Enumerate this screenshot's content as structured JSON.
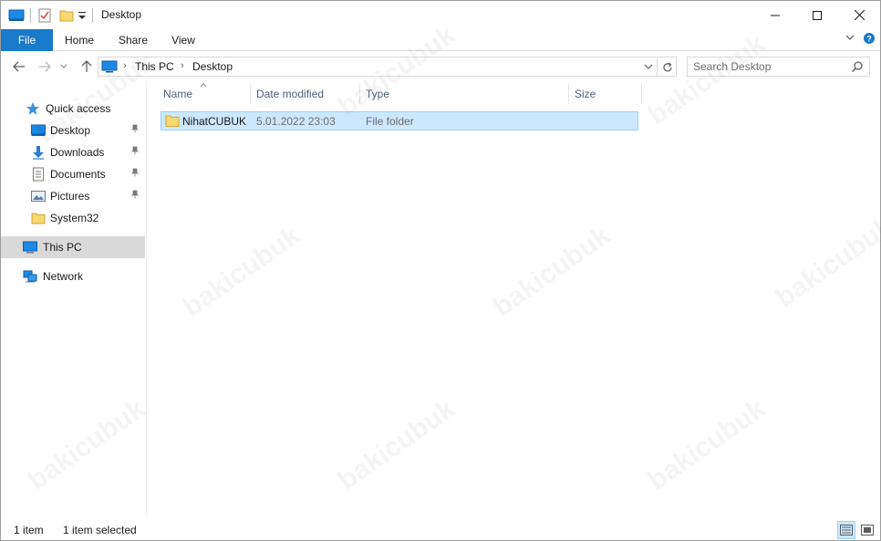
{
  "window": {
    "title": "Desktop"
  },
  "ribbon": {
    "tabs": [
      {
        "label": "File"
      },
      {
        "label": "Home"
      },
      {
        "label": "Share"
      },
      {
        "label": "View"
      }
    ]
  },
  "address": {
    "crumbs": [
      "This PC",
      "Desktop"
    ]
  },
  "search": {
    "placeholder": "Search Desktop"
  },
  "nav": {
    "quick_access": "Quick access",
    "items": [
      {
        "label": "Desktop",
        "pinned": true
      },
      {
        "label": "Downloads",
        "pinned": true
      },
      {
        "label": "Documents",
        "pinned": true
      },
      {
        "label": "Pictures",
        "pinned": true
      },
      {
        "label": "System32",
        "pinned": false
      }
    ],
    "this_pc": "This PC",
    "network": "Network"
  },
  "columns": {
    "name": "Name",
    "date_modified": "Date modified",
    "type": "Type",
    "size": "Size"
  },
  "files": [
    {
      "name": "NihatCUBUK",
      "date_modified": "5.01.2022 23:03",
      "type": "File folder",
      "size": ""
    }
  ],
  "status": {
    "count": "1 item",
    "selection": "1 item selected"
  },
  "watermark": "bakicubuk",
  "colors": {
    "accent": "#1979ca",
    "selection": "#cce8ff",
    "selection_border": "#99d1ff",
    "folder": "#f8d775"
  }
}
